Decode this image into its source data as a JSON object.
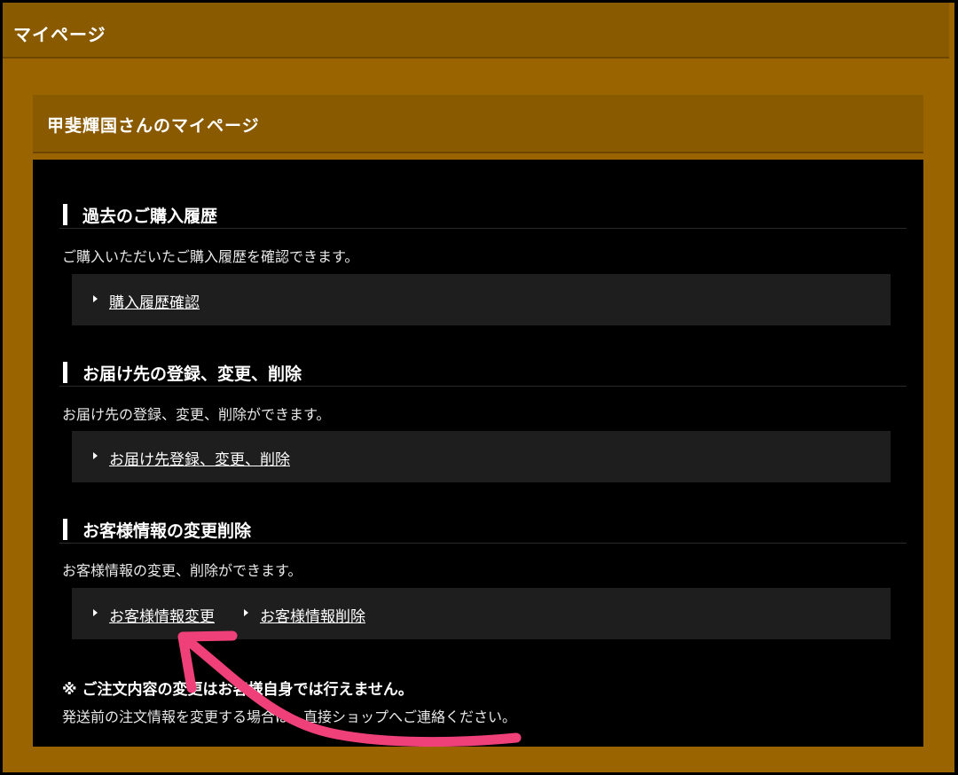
{
  "page": {
    "title": "マイページ"
  },
  "card": {
    "title": "甲斐輝国さんのマイページ"
  },
  "sections": [
    {
      "heading": "過去のご購入履歴",
      "description": "ご購入いただいたご購入履歴を確認できます。",
      "links": [
        "購入履歴確認"
      ]
    },
    {
      "heading": "お届け先の登録、変更、削除",
      "description": "お届け先の登録、変更、削除ができます。",
      "links": [
        "お届け先登録、変更、削除"
      ]
    },
    {
      "heading": "お客様情報の変更削除",
      "description": "お客様情報の変更、削除ができます。",
      "links": [
        "お客様情報変更",
        "お客様情報削除"
      ]
    }
  ],
  "notes": {
    "line1": "※ ご注文内容の変更はお客様自身では行えません。",
    "line2": "発送前の注文情報を変更する場合は、直接ショップへご連絡ください。"
  },
  "annotation": {
    "arrow_color": "#f0407a",
    "points_to": "お客様情報変更"
  },
  "colors": {
    "frame": "#9a6400",
    "header": "#8a5a00",
    "panel": "#000000",
    "link_box": "#1e1e1e"
  }
}
